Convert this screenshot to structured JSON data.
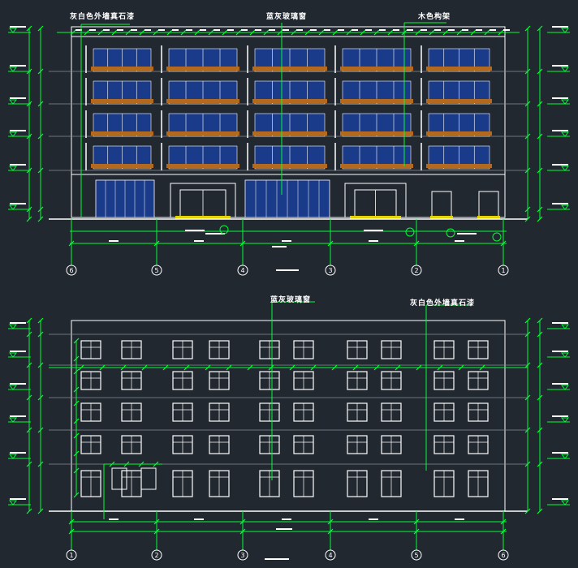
{
  "colors": {
    "background": "#212830",
    "outline": "#ffffff",
    "dimension": "#00ff33",
    "glass": "#1a3a8a",
    "floor_band": "#b36a1f",
    "window_frame": "#ffffff",
    "level_gray": "#8a8f96",
    "entrance_step": "#e6d400",
    "axis_circle": "#ffffff"
  },
  "callouts": {
    "top_left": "灰白色外墙真石漆",
    "top_center": "蓝灰玻璃窗",
    "top_right": "木色构架",
    "bottom_center": "蓝灰玻璃窗",
    "bottom_right": "灰白色外墙真石漆"
  },
  "front_elevation": {
    "floors_upper": 4,
    "axis_labels": [
      "6",
      "5",
      "4",
      "3",
      "2",
      "1"
    ]
  },
  "rear_elevation": {
    "floors": 5,
    "axis_labels": [
      "1",
      "2",
      "3",
      "4",
      "5",
      "6"
    ]
  }
}
